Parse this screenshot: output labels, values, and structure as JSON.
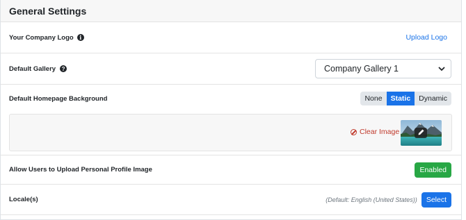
{
  "header": {
    "title": "General Settings"
  },
  "logo": {
    "label": "Your Company Logo",
    "info_glyph": "i",
    "action": "Upload Logo"
  },
  "gallery": {
    "label": "Default Gallery",
    "help_glyph": "?",
    "selected": "Company Gallery 1",
    "chevron": "⌄"
  },
  "background": {
    "label": "Default Homepage Background",
    "options": [
      "None",
      "Static",
      "Dynamic"
    ],
    "active": "Static",
    "clear_label": "Clear Image",
    "edit_icon": "pencil-icon"
  },
  "profile_image": {
    "label": "Allow Users to Upload Personal Profile Image",
    "status": "Enabled"
  },
  "locale": {
    "label": "Locale(s)",
    "default_text": "(Default:  English (United States))",
    "button": "Select"
  },
  "colors": {
    "accent": "#1a73e8",
    "success": "#28a745",
    "danger": "#c0392b",
    "header_bg": "#f7f7f7"
  }
}
